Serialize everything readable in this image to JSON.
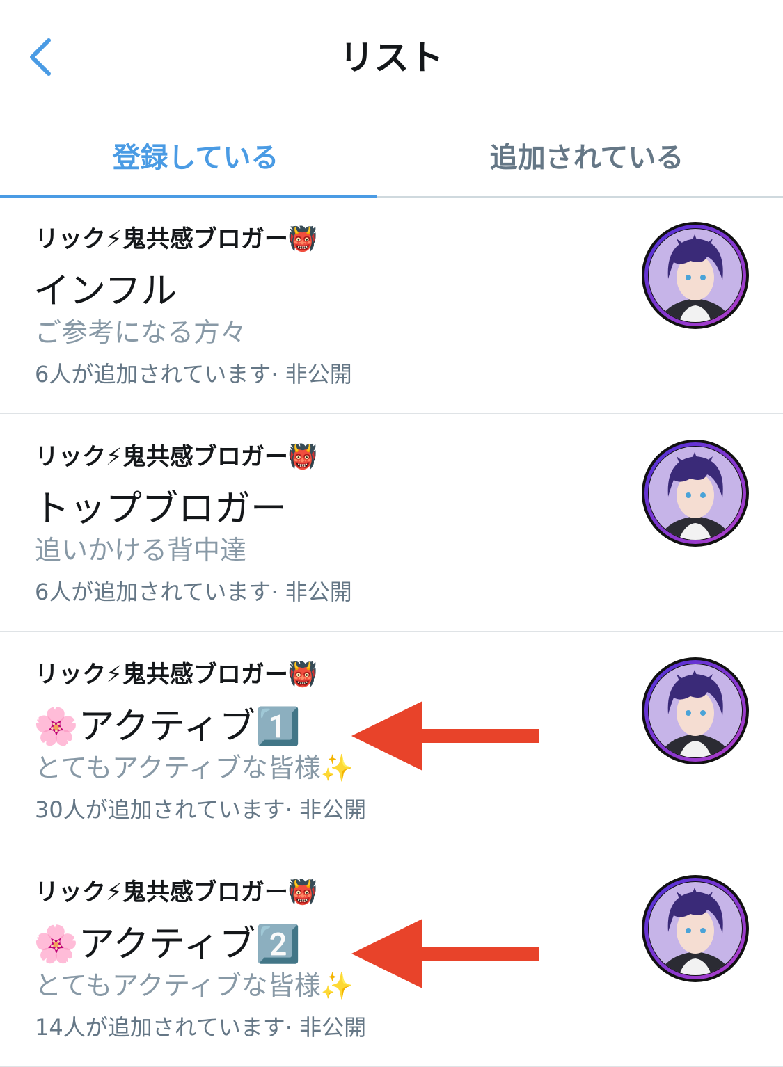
{
  "header": {
    "title": "リスト",
    "back_icon": "chevron-left-icon"
  },
  "tabs": [
    {
      "label": "登録している",
      "active": true
    },
    {
      "label": "追加されている",
      "active": false
    }
  ],
  "colors": {
    "accent": "#4a9be4",
    "annotation": "#e8432a"
  },
  "lists": [
    {
      "owner": "リック⚡鬼共感ブロガー👹",
      "name": "インフル",
      "description": "ご参考になる方々",
      "meta": "6人が追加されています· 非公開",
      "highlighted": false
    },
    {
      "owner": "リック⚡鬼共感ブロガー👹",
      "name": "トップブロガー",
      "description": "追いかける背中達",
      "meta": "6人が追加されています· 非公開",
      "highlighted": false
    },
    {
      "owner": "リック⚡鬼共感ブロガー👹",
      "name": "🌸アクティブ1️⃣",
      "description": "とてもアクティブな皆様✨",
      "meta": "30人が追加されています· 非公開",
      "highlighted": true
    },
    {
      "owner": "リック⚡鬼共感ブロガー👹",
      "name": "🌸アクティブ2️⃣",
      "description": "とてもアクティブな皆様✨",
      "meta": "14人が追加されています· 非公開",
      "highlighted": true
    }
  ]
}
